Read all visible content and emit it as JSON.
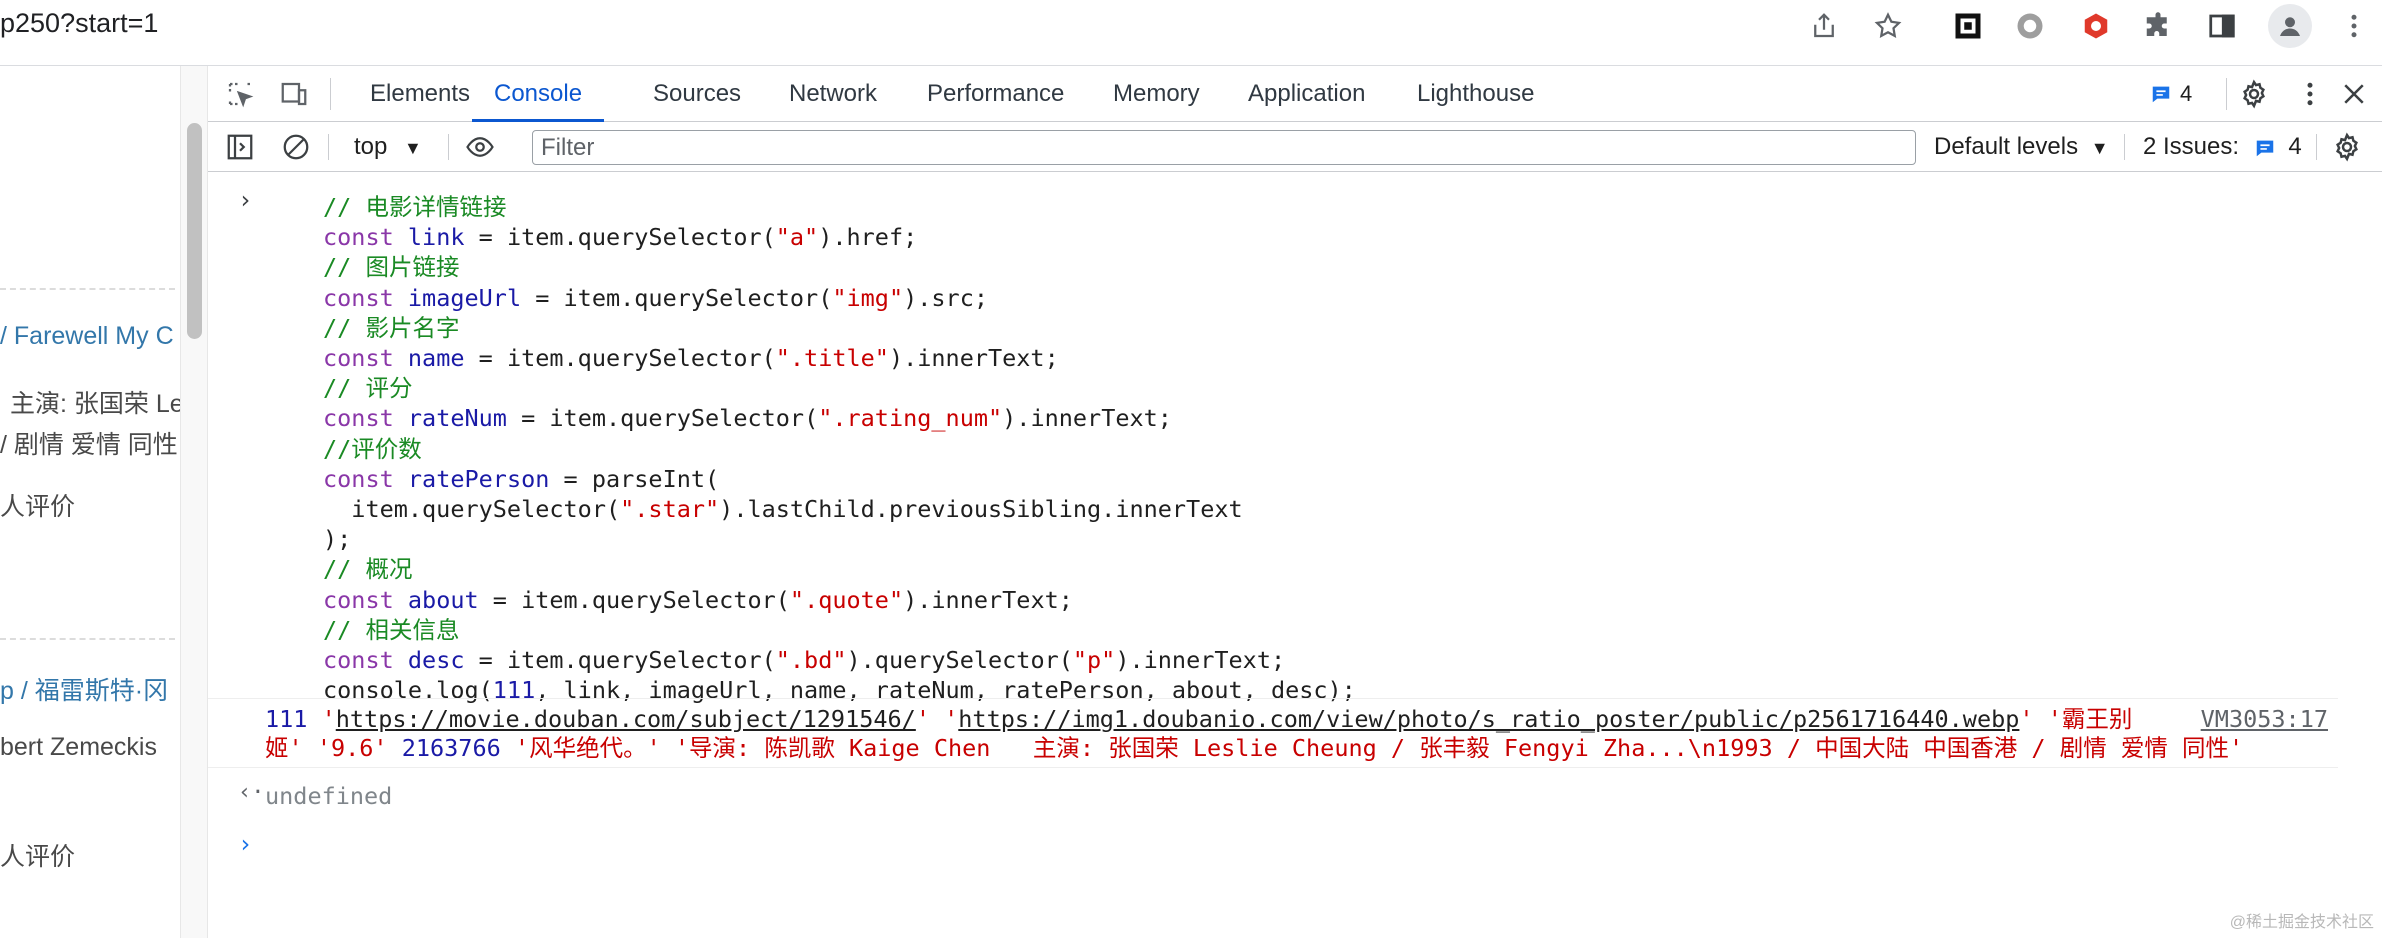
{
  "browser": {
    "url": "p250?start=1",
    "icons": [
      "share-icon",
      "star-icon",
      "extension-qr-icon",
      "extension-circle-icon",
      "extension-shield-icon",
      "puzzle-icon",
      "sidebar-icon",
      "profile-icon",
      "more-vert-icon"
    ]
  },
  "page": {
    "items": [
      {
        "text": "/ Farewell My C",
        "kind": "link"
      },
      {
        "text": "主演: 张国荣 Le",
        "kind": "text"
      },
      {
        "text": "/ 剧情 爱情 同性",
        "kind": "text"
      },
      {
        "text": "人评价",
        "kind": "text"
      },
      {
        "text": "p / 福雷斯特·冈",
        "kind": "link"
      },
      {
        "text": "bert Zemeckis",
        "kind": "text"
      },
      {
        "text": "人评价",
        "kind": "text"
      }
    ]
  },
  "devtools": {
    "tabs": [
      "Elements",
      "Console",
      "Sources",
      "Network",
      "Performance",
      "Memory",
      "Application",
      "Lighthouse"
    ],
    "active_tab": "Console",
    "message_count": "4",
    "toolbar": {
      "context": "top",
      "filter_placeholder": "Filter",
      "levels": "Default levels",
      "issues_label": "2 Issues:",
      "issues_count": "4"
    }
  },
  "console": {
    "code_lines": [
      "// 电影详情链接",
      "const link = item.querySelector(\"a\").href;",
      "// 图片链接",
      "const imageUrl = item.querySelector(\"img\").src;",
      "// 影片名字",
      "const name = item.querySelector(\".title\").innerText;",
      "// 评分",
      "const rateNum = item.querySelector(\".rating_num\").innerText;",
      "//评价数",
      "const ratePerson = parseInt(",
      "  item.querySelector(\".star\").lastChild.previousSibling.innerText",
      ");",
      "// 概况",
      "const about = item.querySelector(\".quote\").innerText;",
      "// 相关信息",
      "const desc = item.querySelector(\".bd\").querySelector(\"p\").innerText;",
      "console.log(111, link, imageUrl, name, rateNum, ratePerson, about, desc);"
    ],
    "log": {
      "num": "111",
      "link": "https://movie.douban.com/subject/1291546/",
      "image": "https://img1.doubanio.com/view/photo/s_ratio_poster/public/p2561716440.webp",
      "name_part1": "'霸王别",
      "name_part2": "姬'",
      "rate": "'9.6'",
      "count": "2163766",
      "about": "'风华绝代。'",
      "desc": "'导演: 陈凯歌 Kaige Chen   主演: 张国荣 Leslie Cheung / 张丰毅 Fengyi Zha...\\n1993 / 中国大陆 中国香港 / 剧情 爱情 同性'",
      "source": "VM3053:17"
    },
    "result": "undefined"
  },
  "watermark": "@稀土掘金技术社区"
}
